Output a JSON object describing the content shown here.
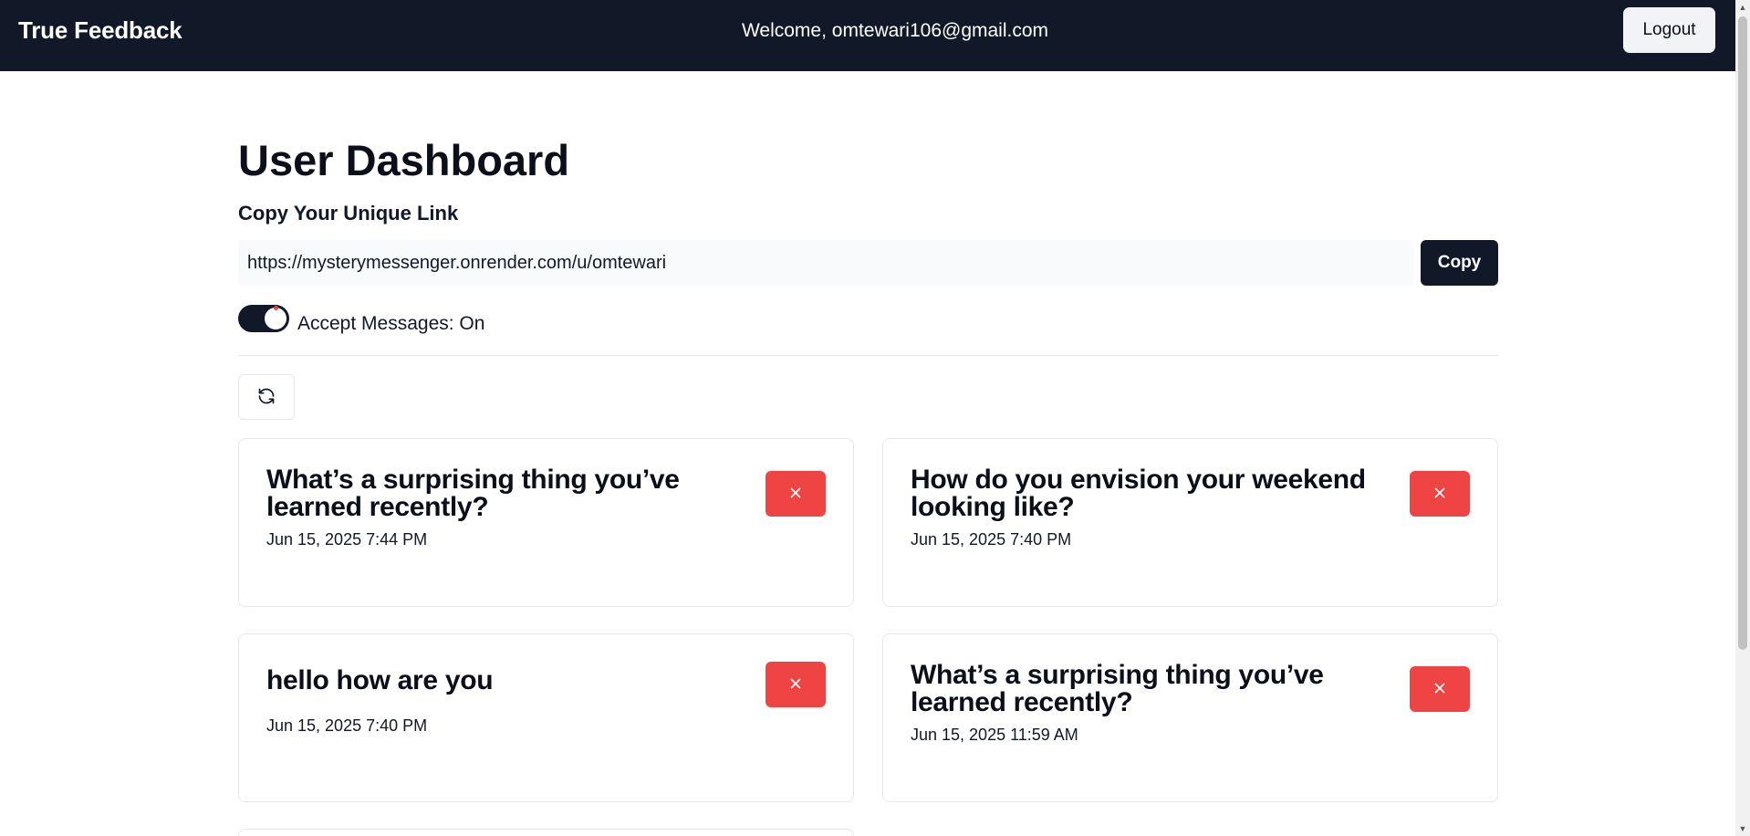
{
  "navbar": {
    "brand": "True Feedback",
    "welcome": "Welcome, omtewari106@gmail.com",
    "logout_label": "Logout"
  },
  "dashboard": {
    "title": "User Dashboard",
    "link_label": "Copy Your Unique Link",
    "unique_link": "https://mysterymessenger.onrender.com/u/omtewari",
    "copy_label": "Copy",
    "accept_messages_label": "Accept Messages: On"
  },
  "messages": [
    {
      "content": "What’s a surprising thing you’ve learned recently?",
      "date": "Jun 15, 2025 7:44 PM"
    },
    {
      "content": "How do you envision your weekend looking like?",
      "date": "Jun 15, 2025 7:40 PM"
    },
    {
      "content": "hello how are you",
      "date": "Jun 15, 2025 7:40 PM"
    },
    {
      "content": "What’s a surprising thing you’ve learned recently?",
      "date": "Jun 15, 2025 11:59 AM"
    }
  ],
  "colors": {
    "navbar_bg": "#111827",
    "primary": "#111827",
    "danger": "#ef4444"
  },
  "icons": {
    "refresh": "refresh-icon",
    "delete": "close-icon"
  }
}
